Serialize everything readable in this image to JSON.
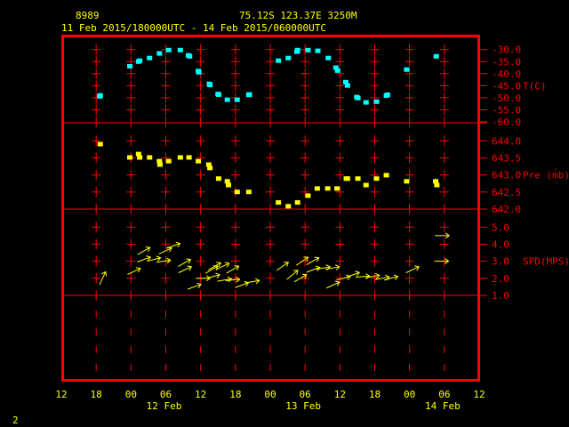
{
  "header": {
    "station": "8989",
    "location": "75.12S   123.37E   3250M",
    "period": "11 Feb 2015/180000UTC - 14 Feb 2015/060000UTC"
  },
  "page_number": "2",
  "colors": {
    "frame": "#ff0000",
    "text": "#ffff00",
    "temperature": "#00ffff",
    "pressure": "#ffff00",
    "wind": "#ffff00"
  },
  "chart_data": [
    {
      "type": "scatter",
      "name": "temperature",
      "ylabel": "T(C)",
      "ylim": [
        -60,
        -30
      ],
      "yticks": [
        "-30.0",
        "-35.0",
        "-40.0",
        "-45.0",
        "-50.0",
        "-55.0",
        "-60.0"
      ],
      "x_units": "hours since 11 Feb 12UTC",
      "points": [
        [
          6.6,
          -49.6
        ],
        [
          6.7,
          -49.2
        ],
        [
          11.8,
          -37.1
        ],
        [
          13.3,
          -35.2
        ],
        [
          13.5,
          -34.8
        ],
        [
          15.2,
          -33.7
        ],
        [
          16.9,
          -31.8
        ],
        [
          18.5,
          -30.4
        ],
        [
          20.5,
          -30.4
        ],
        [
          21.9,
          -32.6
        ],
        [
          22.1,
          -33.0
        ],
        [
          23.6,
          -39.1
        ],
        [
          23.7,
          -39.6
        ],
        [
          25.5,
          -44.4
        ],
        [
          25.6,
          -44.9
        ],
        [
          27.0,
          -48.6
        ],
        [
          27.1,
          -48.9
        ],
        [
          28.6,
          -51.0
        ],
        [
          30.3,
          -51.0
        ],
        [
          32.3,
          -49.0
        ],
        [
          32.4,
          -48.8
        ],
        [
          37.4,
          -34.8
        ],
        [
          39.1,
          -33.7
        ],
        [
          40.6,
          -31.1
        ],
        [
          40.7,
          -30.4
        ],
        [
          42.5,
          -30.4
        ],
        [
          44.2,
          -30.7
        ],
        [
          46.0,
          -33.7
        ],
        [
          47.3,
          -37.7
        ],
        [
          47.6,
          -38.9
        ],
        [
          49.0,
          -43.7
        ],
        [
          49.3,
          -45.1
        ],
        [
          50.9,
          -49.9
        ],
        [
          51.1,
          -50.3
        ],
        [
          52.5,
          -52.1
        ],
        [
          54.3,
          -51.8
        ],
        [
          56.0,
          -49.3
        ],
        [
          56.2,
          -48.9
        ],
        [
          59.5,
          -38.5
        ],
        [
          64.6,
          -33.0
        ]
      ]
    },
    {
      "type": "scatter",
      "name": "pressure",
      "ylabel": "Pre (mb)",
      "ylim": [
        642.0,
        644.0
      ],
      "yticks": [
        "644.0",
        "643.5",
        "643.0",
        "642.5",
        "642.0"
      ],
      "x_units": "hours since 11 Feb 12UTC",
      "points": [
        [
          6.7,
          643.89
        ],
        [
          11.8,
          643.5
        ],
        [
          13.3,
          643.6
        ],
        [
          13.5,
          643.5
        ],
        [
          15.2,
          643.5
        ],
        [
          16.9,
          643.39
        ],
        [
          17.0,
          643.29
        ],
        [
          18.5,
          643.39
        ],
        [
          20.5,
          643.5
        ],
        [
          22.0,
          643.5
        ],
        [
          23.6,
          643.39
        ],
        [
          25.4,
          643.29
        ],
        [
          25.6,
          643.19
        ],
        [
          27.1,
          642.88
        ],
        [
          28.6,
          642.8
        ],
        [
          28.8,
          642.69
        ],
        [
          30.3,
          642.49
        ],
        [
          32.3,
          642.49
        ],
        [
          37.4,
          642.18
        ],
        [
          39.1,
          642.07
        ],
        [
          40.7,
          642.18
        ],
        [
          42.5,
          642.38
        ],
        [
          44.1,
          642.59
        ],
        [
          45.9,
          642.59
        ],
        [
          47.5,
          642.59
        ],
        [
          49.1,
          642.88
        ],
        [
          49.3,
          642.88
        ],
        [
          51.1,
          642.88
        ],
        [
          52.5,
          642.69
        ],
        [
          54.3,
          642.88
        ],
        [
          56.0,
          642.98
        ],
        [
          59.5,
          642.8
        ],
        [
          64.5,
          642.8
        ],
        [
          64.7,
          642.69
        ]
      ]
    },
    {
      "type": "scatter",
      "name": "wind_speed",
      "ylabel": "SPD(MPS)",
      "ylim": [
        1.0,
        5.0
      ],
      "yticks": [
        "5.0",
        "4.0",
        "3.0",
        "2.0",
        "1.0"
      ],
      "x_units": "hours since 11 Feb 12UTC",
      "point_format": "[hour, speed_mps, arrow_angle_deg_above_east]",
      "points": [
        [
          7.1,
          2.0,
          65
        ],
        [
          12.5,
          2.4,
          25
        ],
        [
          14.2,
          3.6,
          30
        ],
        [
          14.2,
          3.1,
          20
        ],
        [
          15.9,
          3.1,
          15
        ],
        [
          17.6,
          3.0,
          10
        ],
        [
          17.9,
          3.6,
          25
        ],
        [
          19.3,
          3.9,
          20
        ],
        [
          21.2,
          2.9,
          30
        ],
        [
          21.3,
          2.5,
          25
        ],
        [
          22.9,
          1.5,
          20
        ],
        [
          24.4,
          2.0,
          0
        ],
        [
          26.1,
          2.1,
          15
        ],
        [
          25.9,
          2.5,
          30
        ],
        [
          26.4,
          2.7,
          30
        ],
        [
          27.8,
          2.7,
          25
        ],
        [
          29.5,
          2.5,
          30
        ],
        [
          28.1,
          1.9,
          10
        ],
        [
          29.5,
          1.9,
          5
        ],
        [
          31.1,
          1.6,
          20
        ],
        [
          32.9,
          1.8,
          10
        ],
        [
          38.1,
          2.7,
          35
        ],
        [
          39.8,
          2.2,
          40
        ],
        [
          41.5,
          3.0,
          35
        ],
        [
          43.3,
          3.0,
          30
        ],
        [
          41.2,
          2.0,
          30
        ],
        [
          43.4,
          2.5,
          20
        ],
        [
          45.1,
          2.6,
          10
        ],
        [
          46.7,
          2.6,
          10
        ],
        [
          46.8,
          1.6,
          25
        ],
        [
          48.6,
          2.0,
          15
        ],
        [
          50.2,
          2.2,
          20
        ],
        [
          51.9,
          2.1,
          5
        ],
        [
          53.6,
          2.1,
          10
        ],
        [
          55.3,
          2.0,
          10
        ],
        [
          56.8,
          2.0,
          15
        ],
        [
          60.5,
          2.5,
          25
        ],
        [
          65.6,
          4.5,
          0
        ],
        [
          65.5,
          3.0,
          0
        ]
      ]
    }
  ],
  "x_axis": {
    "range_hours": [
      0,
      72
    ],
    "tick_labels": [
      "12",
      "18",
      "00",
      "06",
      "12",
      "18",
      "00",
      "06",
      "12",
      "18",
      "00",
      "06",
      "12"
    ],
    "date_labels": [
      {
        "hour": 18,
        "label": "12 Feb"
      },
      {
        "hour": 42,
        "label": "13 Feb"
      },
      {
        "hour": 66,
        "label": "14 Feb"
      }
    ]
  }
}
